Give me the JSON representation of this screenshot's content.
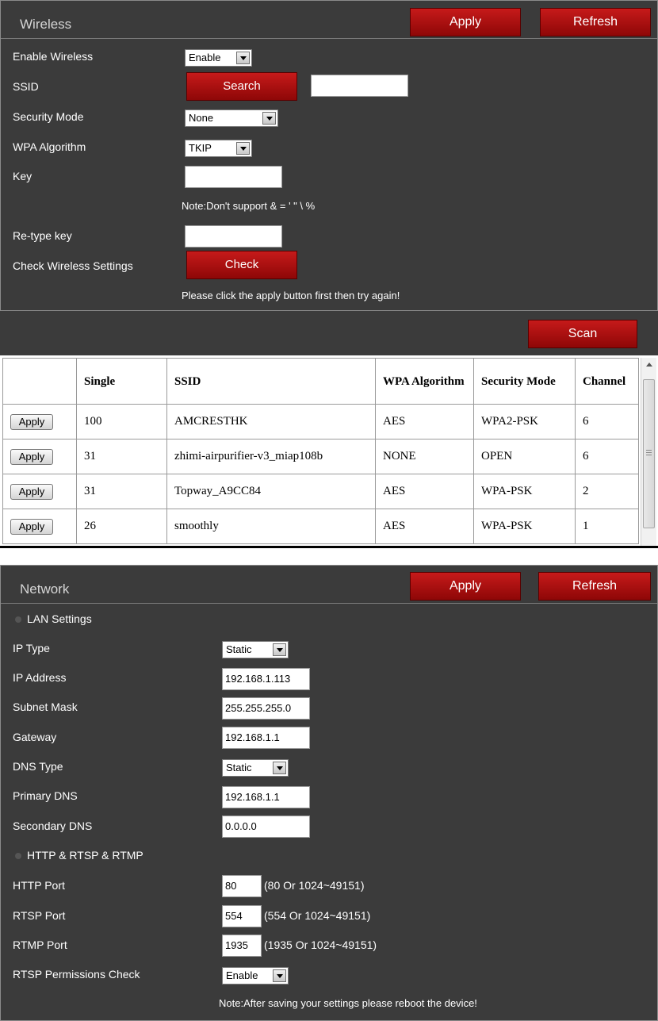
{
  "wireless": {
    "title": "Wireless",
    "apply_label": "Apply",
    "refresh_label": "Refresh",
    "enable_label": "Enable Wireless",
    "enable_value": "Enable",
    "ssid_label": "SSID",
    "search_label": "Search",
    "ssid_value": "",
    "security_label": "Security Mode",
    "security_value": "None",
    "wpa_label": "WPA Algorithm",
    "wpa_value": "TKIP",
    "key_label": "Key",
    "key_value": "",
    "key_note": "Note:Don't support & = ' \" \\ %",
    "retype_label": "Re-type key",
    "retype_value": "",
    "check_label": "Check Wireless Settings",
    "check_button": "Check",
    "check_note": "Please click the apply button first then try again!"
  },
  "scan": {
    "scan_label": "Scan",
    "headers": [
      "",
      "Single",
      "SSID",
      "WPA Algorithm",
      "Security Mode",
      "Channel"
    ],
    "row_button": "Apply",
    "rows": [
      {
        "single": "100",
        "ssid": "AMCRESTHK",
        "wpa": "AES",
        "security": "WPA2-PSK",
        "channel": "6"
      },
      {
        "single": "31",
        "ssid": "zhimi-airpurifier-v3_miap108b",
        "wpa": "NONE",
        "security": "OPEN",
        "channel": "6"
      },
      {
        "single": "31",
        "ssid": "Topway_A9CC84",
        "wpa": "AES",
        "security": "WPA-PSK",
        "channel": "2"
      },
      {
        "single": "26",
        "ssid": "smoothly",
        "wpa": "AES",
        "security": "WPA-PSK",
        "channel": "1"
      }
    ]
  },
  "network": {
    "title": "Network",
    "apply_label": "Apply",
    "refresh_label": "Refresh",
    "lan_section": "LAN Settings",
    "ip_type_label": "IP Type",
    "ip_type_value": "Static",
    "ip_label": "IP Address",
    "ip_value": "192.168.1.113",
    "mask_label": "Subnet Mask",
    "mask_value": "255.255.255.0",
    "gateway_label": "Gateway",
    "gateway_value": "192.168.1.1",
    "dns_type_label": "DNS Type",
    "dns_type_value": "Static",
    "dns1_label": "Primary DNS",
    "dns1_value": "192.168.1.1",
    "dns2_label": "Secondary DNS",
    "dns2_value": "0.0.0.0",
    "http_section": "HTTP & RTSP & RTMP",
    "http_label": "HTTP Port",
    "http_value": "80",
    "http_hint": "(80 Or 1024~49151)",
    "rtsp_label": "RTSP Port",
    "rtsp_value": "554",
    "rtsp_hint": "(554 Or 1024~49151)",
    "rtmp_label": "RTMP Port",
    "rtmp_value": "1935",
    "rtmp_hint": "(1935 Or 1024~49151)",
    "perm_label": "RTSP Permissions Check",
    "perm_value": "Enable",
    "reboot_note": "Note:After saving your settings please reboot the device!"
  }
}
